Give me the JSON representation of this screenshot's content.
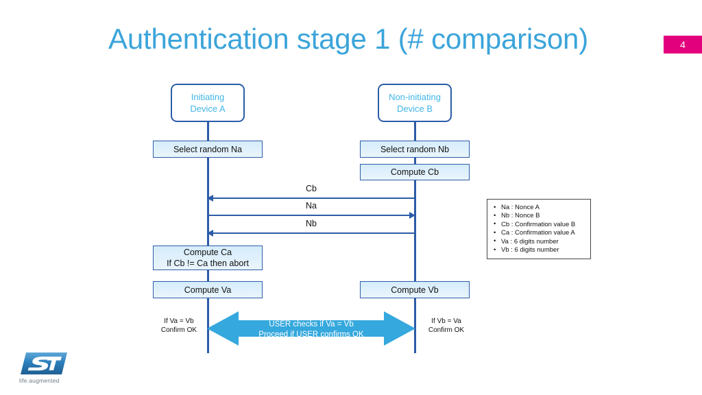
{
  "slide": {
    "title": "Authentication stage 1 (# comparison)",
    "page_number": "4",
    "title_color": "#3ba4da",
    "badge_color": "#e2007d"
  },
  "diagram": {
    "type": "sequence-diagram",
    "devices": [
      {
        "id": "a",
        "line1": "Initiating",
        "line2": "Device A"
      },
      {
        "id": "b",
        "line1": "Non-initiating",
        "line2": "Device B"
      }
    ],
    "process_boxes": [
      {
        "id": "select-na",
        "lane": "a",
        "line1": "Select random Na",
        "line2": ""
      },
      {
        "id": "select-nb",
        "lane": "b",
        "line1": "Select random Nb",
        "line2": ""
      },
      {
        "id": "compute-cb",
        "lane": "b",
        "line1": "Compute Cb",
        "line2": ""
      },
      {
        "id": "compute-ca",
        "lane": "a",
        "line1": "Compute Ca",
        "line2": "If Cb != Ca then abort"
      },
      {
        "id": "compute-va",
        "lane": "a",
        "line1": "Compute Va",
        "line2": ""
      },
      {
        "id": "compute-vb",
        "lane": "b",
        "line1": "Compute Vb",
        "line2": ""
      }
    ],
    "messages": [
      {
        "id": "cb",
        "label": "Cb",
        "direction": "b-to-a"
      },
      {
        "id": "na",
        "label": "Na",
        "direction": "a-to-b"
      },
      {
        "id": "nb",
        "label": "Nb",
        "direction": "b-to-a"
      }
    ],
    "user_check": {
      "line1": "USER checks if Va = Vb",
      "line2": "Proceed if USER confirms OK",
      "arrow_color": "#35a8dd",
      "left_note_line1": "If Va = Vb",
      "left_note_line2": "Confirm OK",
      "right_note_line1": "If Vb = Va",
      "right_note_line2": "Confirm OK"
    },
    "legend": [
      "Na : Nonce A",
      "Nb : Nonce B",
      "Cb : Confirmation value B",
      "Ca : Confirmation value A",
      "Va : 6 digits number",
      "Vb : 6 digits number"
    ]
  },
  "branding": {
    "tagline": "life.augmented"
  }
}
